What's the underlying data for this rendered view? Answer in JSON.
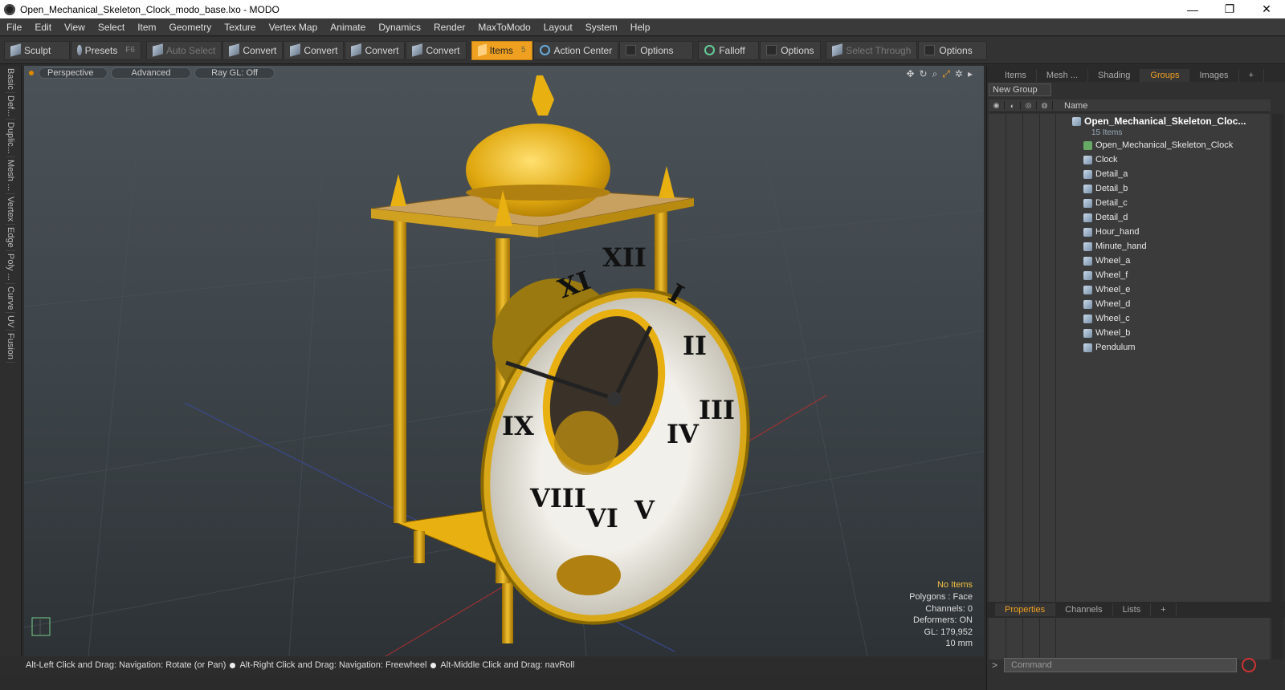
{
  "window": {
    "title": "Open_Mechanical_Skeleton_Clock_modo_base.lxo - MODO",
    "min": "—",
    "max": "❐",
    "close": "✕"
  },
  "menu": [
    "File",
    "Edit",
    "View",
    "Select",
    "Item",
    "Geometry",
    "Texture",
    "Vertex Map",
    "Animate",
    "Dynamics",
    "Render",
    "MaxToModo",
    "Layout",
    "System",
    "Help"
  ],
  "toolbar": {
    "sculpt": "Sculpt",
    "presets": "Presets",
    "presets_key": "F6",
    "auto_select": "Auto Select",
    "convert1": "Convert",
    "convert2": "Convert",
    "convert3": "Convert",
    "convert4": "Convert",
    "items": "Items",
    "items_key": "5",
    "action_center": "Action Center",
    "options1": "Options",
    "falloff": "Falloff",
    "options2": "Options",
    "select_through": "Select Through",
    "options3": "Options"
  },
  "left_tabs": [
    "Basic",
    "Def...",
    "Duplic...",
    "Mesh ...",
    "Vertex",
    "Edge",
    "Poly ...",
    "Curve",
    "UV",
    "Fusion"
  ],
  "viewport": {
    "perspective": "Perspective",
    "advanced": "Advanced",
    "raygl": "Ray GL: Off",
    "stats": {
      "no_items": "No Items",
      "polygons": "Polygons : Face",
      "channels": "Channels: 0",
      "deformers": "Deformers: ON",
      "gl": "GL: 179,952",
      "scale": "10 mm"
    }
  },
  "statusbar": {
    "hint1": "Alt-Left Click and Drag: Navigation: Rotate (or Pan)",
    "hint2": "Alt-Right Click and Drag: Navigation: Freewheel",
    "hint3": "Alt-Middle Click and Drag: navRoll"
  },
  "right_panel": {
    "tabs": [
      "Items",
      "Mesh ...",
      "Shading",
      "Groups",
      "Images"
    ],
    "selected_tab": "Groups",
    "new_group": "New Group",
    "name_header": "Name",
    "root": {
      "name": "Open_Mechanical_Skeleton_Cloc...",
      "count": "15 Items"
    },
    "items": [
      "Open_Mechanical_Skeleton_Clock",
      "Clock",
      "Detail_a",
      "Detail_b",
      "Detail_c",
      "Detail_d",
      "Hour_hand",
      "Minute_hand",
      "Wheel_a",
      "Wheel_f",
      "Wheel_e",
      "Wheel_d",
      "Wheel_c",
      "Wheel_b",
      "Pendulum"
    ],
    "bottom_tabs": [
      "Properties",
      "Channels",
      "Lists"
    ],
    "command_placeholder": "Command"
  },
  "colors": {
    "accent": "#f0a020",
    "gold": "#e8b010",
    "dial": "#e8e6de"
  }
}
